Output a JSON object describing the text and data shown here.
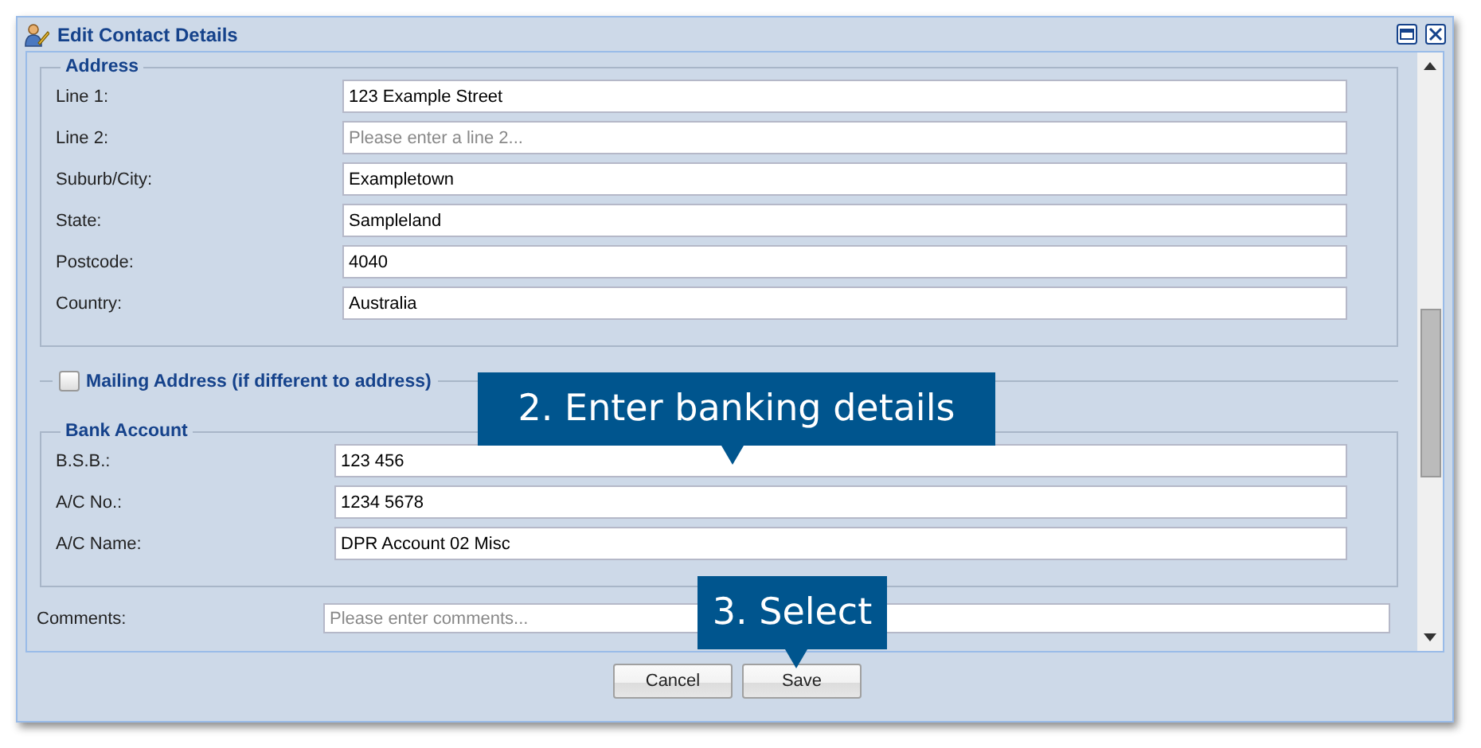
{
  "window": {
    "title": "Edit Contact Details"
  },
  "address": {
    "legend": "Address",
    "fields": [
      {
        "label": "Line 1:",
        "value": "123 Example Street"
      },
      {
        "label": "Line 2:",
        "placeholder": "Please enter a line 2..."
      },
      {
        "label": "Suburb/City:",
        "value": "Exampletown"
      },
      {
        "label": "State:",
        "value": "Sampleland"
      },
      {
        "label": "Postcode:",
        "value": "4040"
      },
      {
        "label": "Country:",
        "value": "Australia"
      }
    ]
  },
  "mailing_address": {
    "label": "Mailing Address (if different to address)",
    "checked": false
  },
  "bank_account": {
    "legend": "Bank Account",
    "fields": [
      {
        "label": "B.S.B.:",
        "value": "123 456"
      },
      {
        "label": "A/C No.:",
        "value": "1234 5678"
      },
      {
        "label": "A/C Name:",
        "value": "DPR Account 02 Misc"
      }
    ]
  },
  "comments": {
    "label": "Comments:",
    "placeholder": "Please enter comments..."
  },
  "buttons": [
    "Cancel",
    "Save"
  ],
  "callouts": [
    {
      "text": "2. Enter banking details"
    },
    {
      "text": "3. Select"
    }
  ]
}
